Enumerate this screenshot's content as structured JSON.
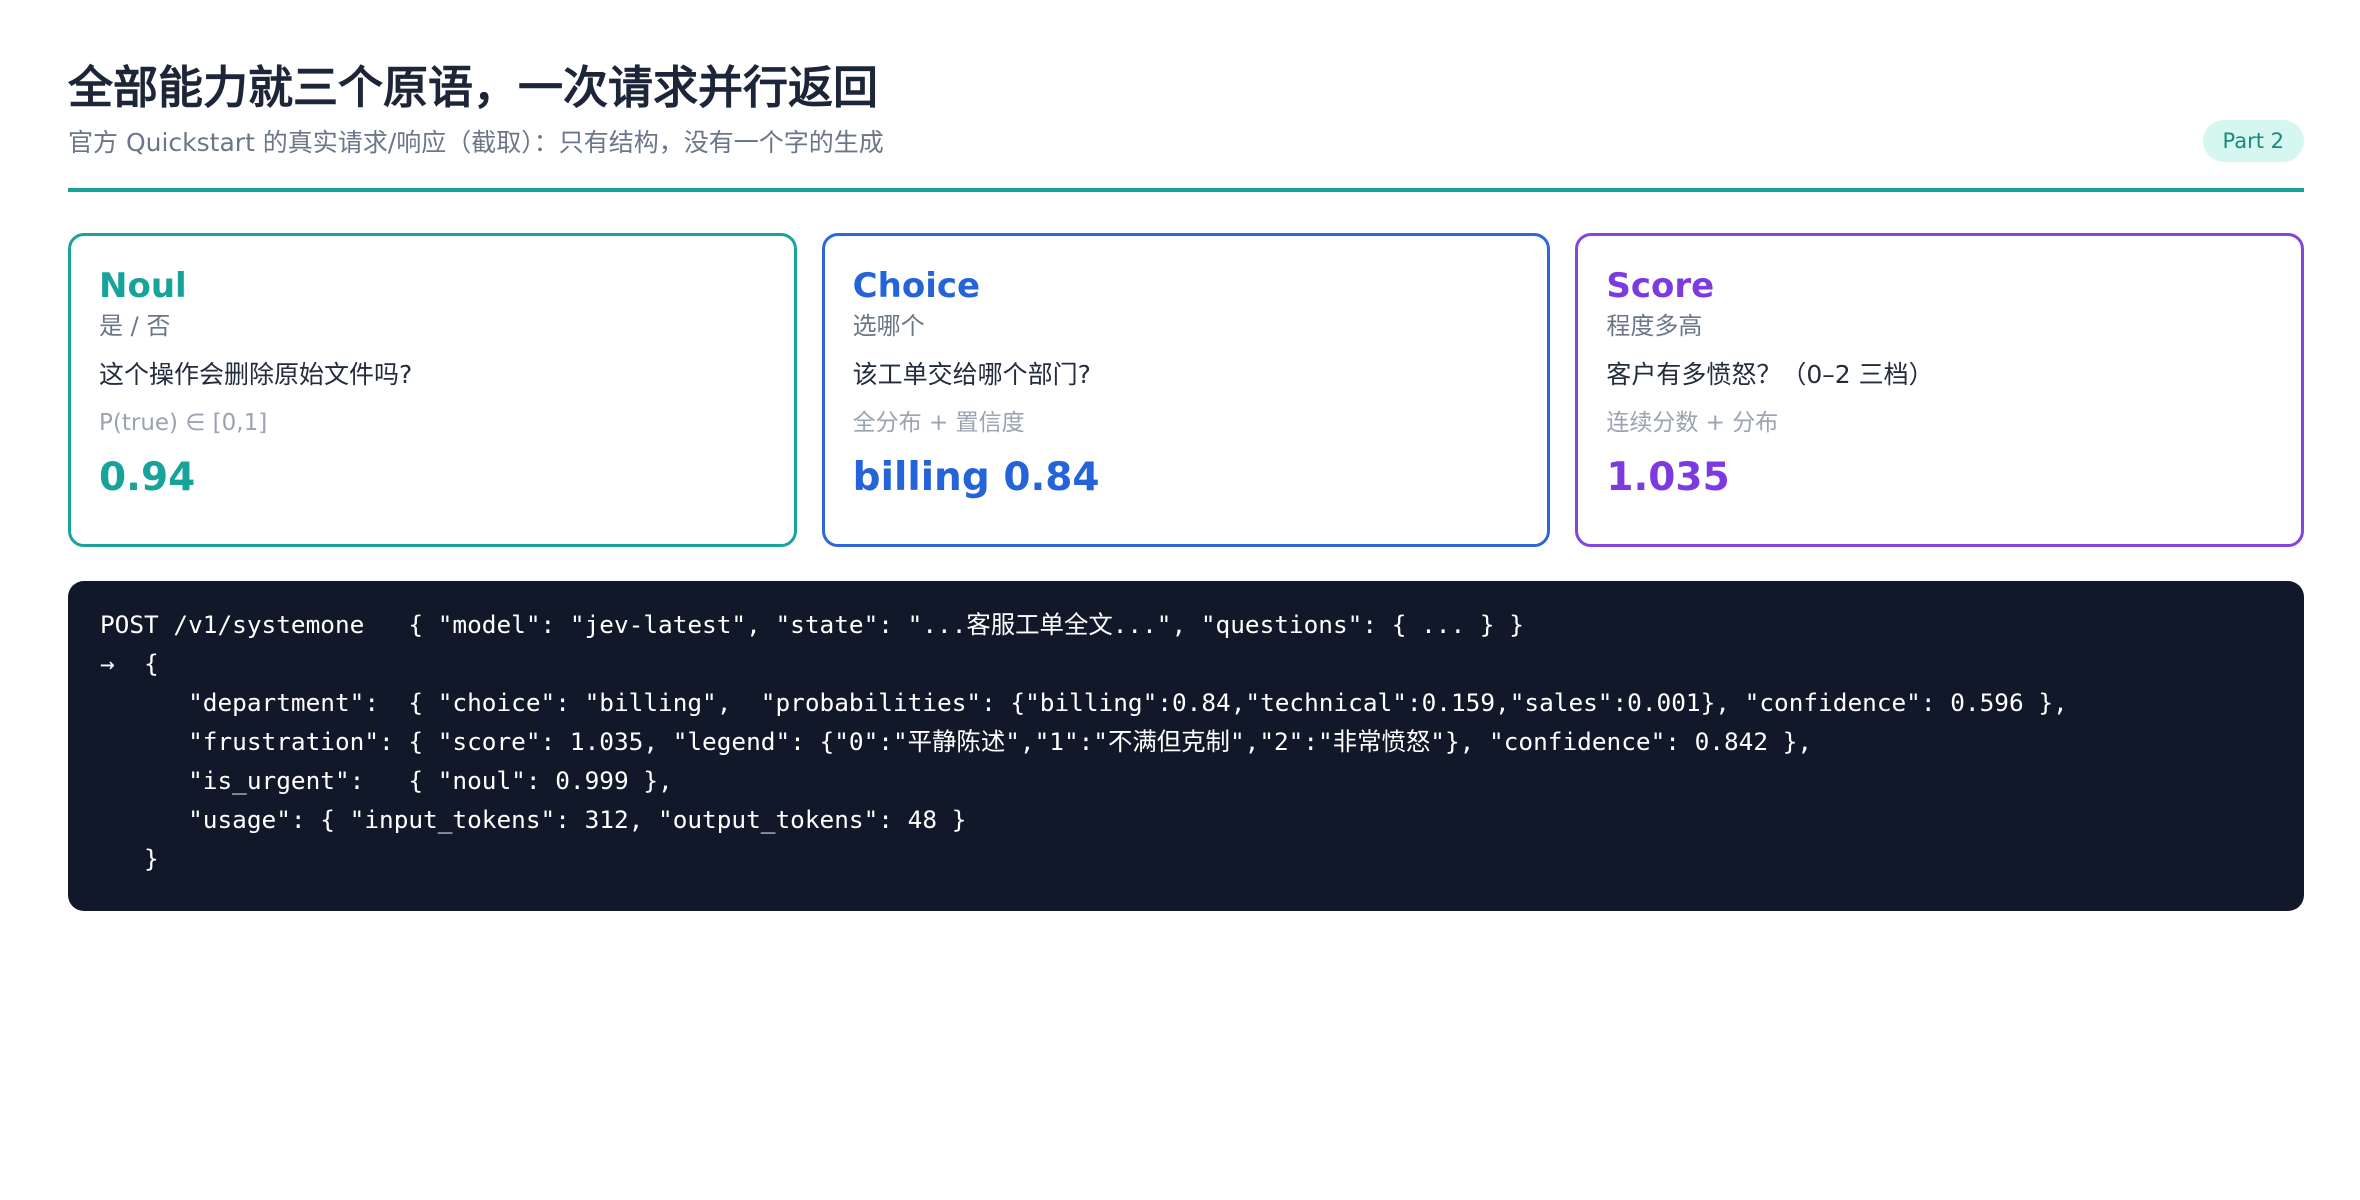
{
  "header": {
    "title": "全部能力就三个原语，一次请求并行返回",
    "subtitle": "官方 Quickstart 的真实请求/响应（截取）：只有结构，没有一个字的生成",
    "badge": "Part 2"
  },
  "colors": {
    "accent_teal": "#17a39a",
    "accent_blue": "#2563d9",
    "accent_purple": "#7c3ae0",
    "code_bg": "#111829"
  },
  "cards": [
    {
      "title": "Noul",
      "subtitle": "是 / 否",
      "question": "这个操作会删除原始文件吗?",
      "meta": "P(true) ∈ [0,1]",
      "value": "0.94"
    },
    {
      "title": "Choice",
      "subtitle": "选哪个",
      "question": "该工单交给哪个部门?",
      "meta": "全分布 + 置信度",
      "value": "billing 0.84"
    },
    {
      "title": "Score",
      "subtitle": "程度多高",
      "question": "客户有多愤怒？（0–2 三档）",
      "meta": "连续分数 + 分布",
      "value": "1.035"
    }
  ],
  "code": {
    "lines": [
      "POST /v1/systemone   { \"model\": \"jev-latest\", \"state\": \"...客服工单全文...\", \"questions\": { ... } }",
      "→  {",
      "      \"department\":  { \"choice\": \"billing\",  \"probabilities\": {\"billing\":0.84,\"technical\":0.159,\"sales\":0.001}, \"confidence\": 0.596 },",
      "      \"frustration\": { \"score\": 1.035, \"legend\": {\"0\":\"平静陈述\",\"1\":\"不满但克制\",\"2\":\"非常愤怒\"}, \"confidence\": 0.842 },",
      "      \"is_urgent\":   { \"noul\": 0.999 },",
      "      \"usage\": { \"input_tokens\": 312, \"output_tokens\": 48 }",
      "   }"
    ]
  }
}
